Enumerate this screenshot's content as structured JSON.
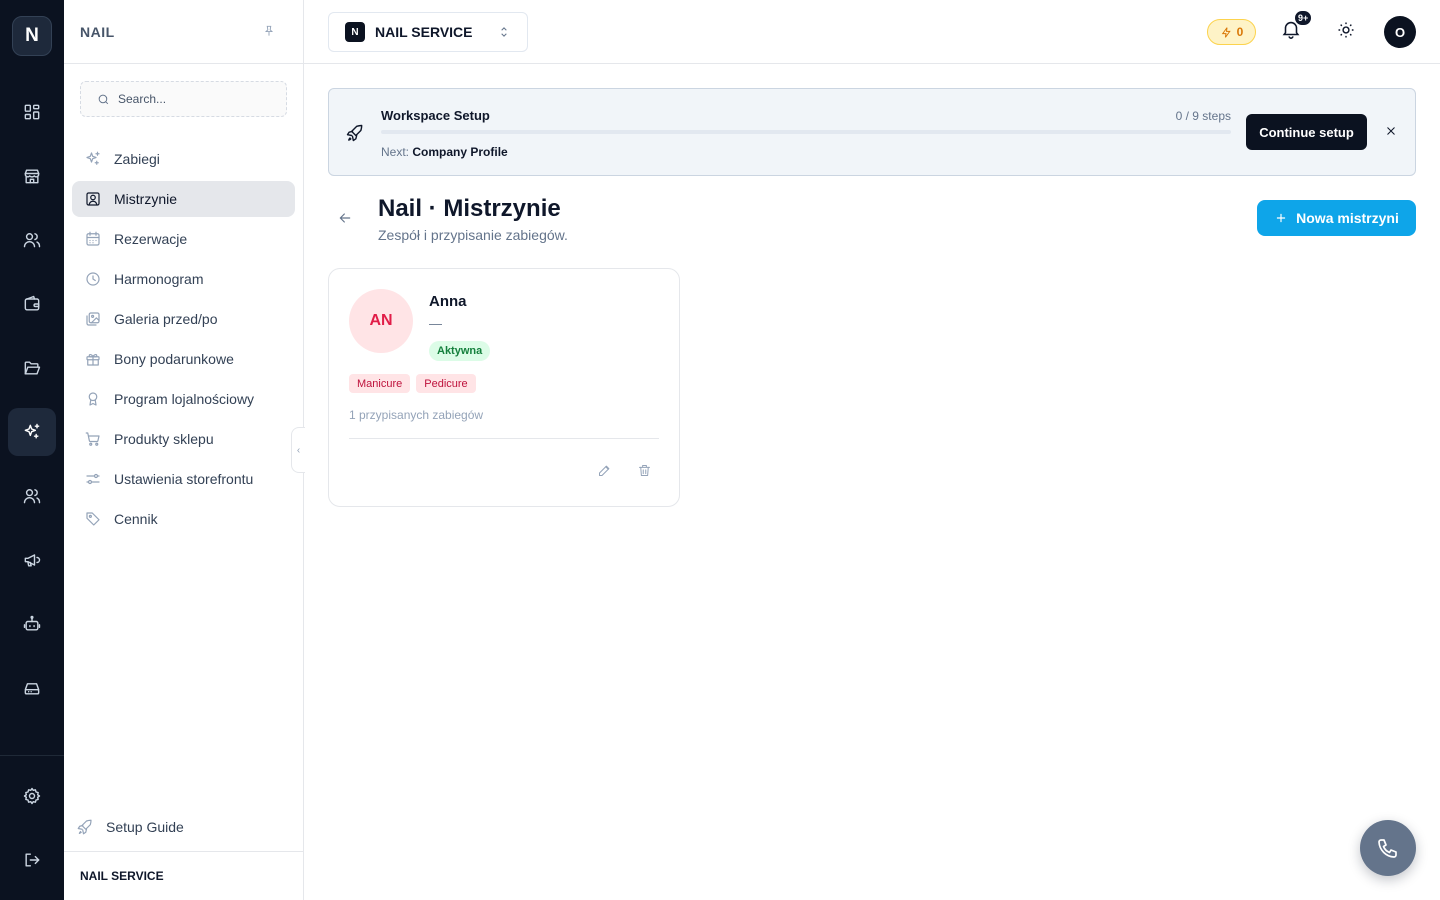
{
  "rail": {
    "logo": "N"
  },
  "sidebar": {
    "title": "NAIL",
    "search_placeholder": "Search...",
    "items": [
      {
        "label": "Zabiegi",
        "icon": "sparkles-icon"
      },
      {
        "label": "Mistrzynie",
        "icon": "user-square-icon",
        "active": true
      },
      {
        "label": "Rezerwacje",
        "icon": "calendar-icon"
      },
      {
        "label": "Harmonogram",
        "icon": "clock-icon"
      },
      {
        "label": "Galeria przed/po",
        "icon": "images-icon"
      },
      {
        "label": "Bony podarunkowe",
        "icon": "gift-icon"
      },
      {
        "label": "Program lojalnościowy",
        "icon": "award-icon"
      },
      {
        "label": "Produkty sklepu",
        "icon": "cart-icon"
      },
      {
        "label": "Ustawienia storefrontu",
        "icon": "sliders-icon"
      },
      {
        "label": "Cennik",
        "icon": "tag-icon"
      }
    ],
    "setup_guide": "Setup Guide",
    "footer": "NAIL SERVICE"
  },
  "header": {
    "workspace_badge": "N",
    "workspace_name": "NAIL SERVICE",
    "credits": "0",
    "notifications_badge": "9+",
    "user_initial": "O"
  },
  "banner": {
    "title": "Workspace Setup",
    "steps": "0 / 9 steps",
    "progress": 0,
    "next_label": "Next:",
    "next_value": "Company Profile",
    "continue_label": "Continue setup"
  },
  "page": {
    "title": "Nail · Mistrzynie",
    "subtitle": "Zespół i przypisanie zabiegów.",
    "new_button": "Nowa mistrzyni"
  },
  "cards": [
    {
      "initials": "AN",
      "name": "Anna",
      "role": "—",
      "status": "Aktywna",
      "tags": [
        "Manicure",
        "Pedicure"
      ],
      "count": "1 przypisanych zabiegów"
    }
  ],
  "colors": {
    "rail_bg": "#0b1220",
    "accent": "#0ea5e9",
    "status_active": "#15803d",
    "tag_text": "#be123c"
  }
}
